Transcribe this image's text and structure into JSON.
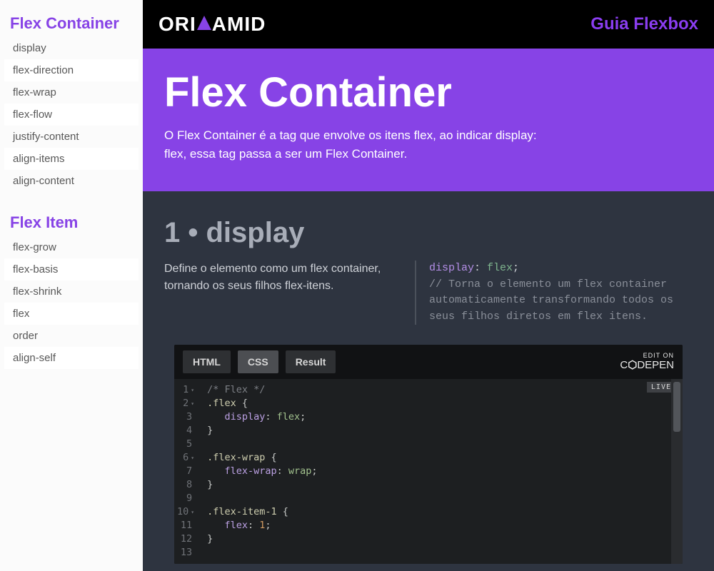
{
  "sidebar": {
    "group1_title": "Flex Container",
    "group1_items": [
      "display",
      "flex-direction",
      "flex-wrap",
      "flex-flow",
      "justify-content",
      "align-items",
      "align-content"
    ],
    "group2_title": "Flex Item",
    "group2_items": [
      "flex-grow",
      "flex-basis",
      "flex-shrink",
      "flex",
      "order",
      "align-self"
    ]
  },
  "topbar": {
    "logo_left": "ORI",
    "logo_right": "AMID",
    "guide": "Guia Flexbox"
  },
  "hero": {
    "title": "Flex Container",
    "desc": "O Flex Container é a tag que envolve os itens flex, ao indicar display: flex, essa tag passa a ser um Flex Container."
  },
  "section1": {
    "title": "1 • display",
    "desc": "Define o elemento como um flex container, tornando os seus filhos flex-itens.",
    "code_prop": "display",
    "code_val": "flex",
    "code_comment": "// Torna o elemento um flex container automaticamente transformando todos os seus filhos diretos em flex itens."
  },
  "pen": {
    "tabs": {
      "html": "HTML",
      "css": "CSS",
      "result": "Result"
    },
    "edit_top": "EDIT ON",
    "edit_brand": "C    DEPEN",
    "live": "LIVE",
    "lines": [
      {
        "n": "1",
        "fold": true,
        "tokens": [
          {
            "t": "/* Flex */",
            "c": "c-com"
          }
        ]
      },
      {
        "n": "2",
        "fold": true,
        "tokens": [
          {
            "t": ".flex ",
            "c": "c-sel"
          },
          {
            "t": "{",
            "c": "c-punc"
          }
        ]
      },
      {
        "n": "3",
        "fold": false,
        "tokens": [
          {
            "t": "   ",
            "c": ""
          },
          {
            "t": "display",
            "c": "c-prop"
          },
          {
            "t": ": ",
            "c": "c-punc"
          },
          {
            "t": "flex",
            "c": "c-val"
          },
          {
            "t": ";",
            "c": "c-punc"
          }
        ]
      },
      {
        "n": "4",
        "fold": false,
        "tokens": [
          {
            "t": "}",
            "c": "c-punc"
          }
        ]
      },
      {
        "n": "5",
        "fold": false,
        "tokens": []
      },
      {
        "n": "6",
        "fold": true,
        "tokens": [
          {
            "t": ".flex-wrap ",
            "c": "c-sel"
          },
          {
            "t": "{",
            "c": "c-punc"
          }
        ]
      },
      {
        "n": "7",
        "fold": false,
        "tokens": [
          {
            "t": "   ",
            "c": ""
          },
          {
            "t": "flex-wrap",
            "c": "c-prop"
          },
          {
            "t": ": ",
            "c": "c-punc"
          },
          {
            "t": "wrap",
            "c": "c-val"
          },
          {
            "t": ";",
            "c": "c-punc"
          }
        ]
      },
      {
        "n": "8",
        "fold": false,
        "tokens": [
          {
            "t": "}",
            "c": "c-punc"
          }
        ]
      },
      {
        "n": "9",
        "fold": false,
        "tokens": []
      },
      {
        "n": "10",
        "fold": true,
        "tokens": [
          {
            "t": ".flex-item-1 ",
            "c": "c-sel"
          },
          {
            "t": "{",
            "c": "c-punc"
          }
        ]
      },
      {
        "n": "11",
        "fold": false,
        "tokens": [
          {
            "t": "   ",
            "c": ""
          },
          {
            "t": "flex",
            "c": "c-prop"
          },
          {
            "t": ": ",
            "c": "c-punc"
          },
          {
            "t": "1",
            "c": "c-num"
          },
          {
            "t": ";",
            "c": "c-punc"
          }
        ]
      },
      {
        "n": "12",
        "fold": false,
        "tokens": [
          {
            "t": "}",
            "c": "c-punc"
          }
        ]
      },
      {
        "n": "13",
        "fold": false,
        "tokens": []
      }
    ]
  }
}
